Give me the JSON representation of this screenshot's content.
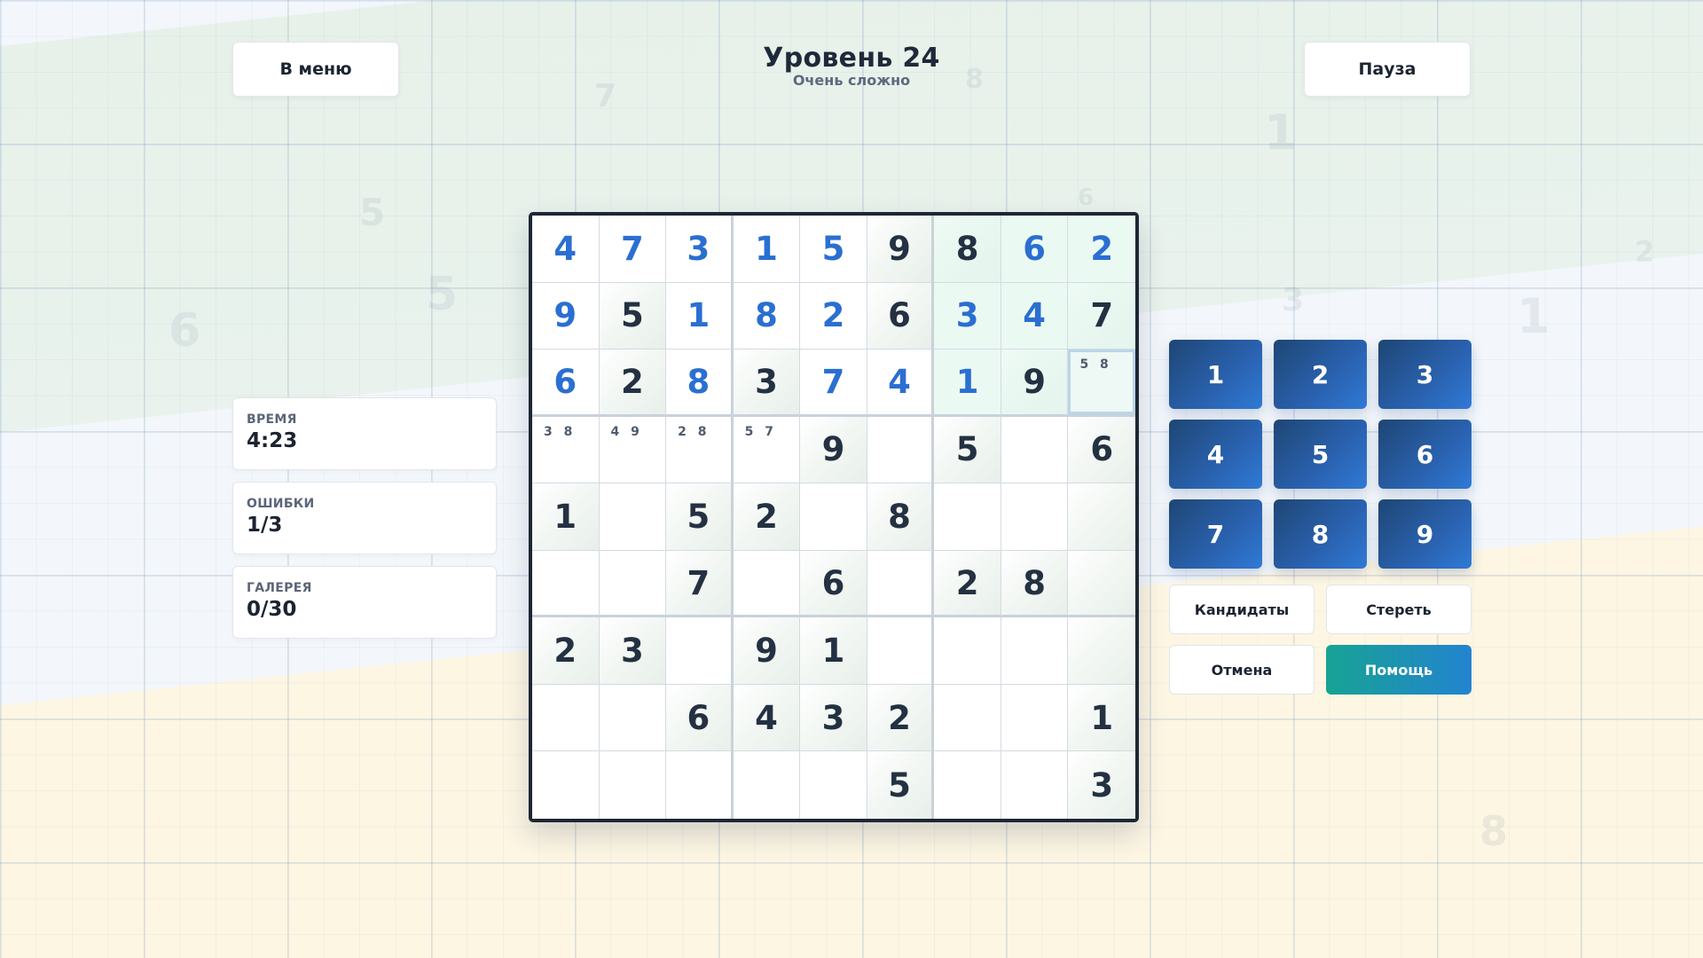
{
  "header": {
    "menu_label": "В меню",
    "title": "Уровень 24",
    "difficulty": "Очень сложно",
    "pause_label": "Пауза"
  },
  "stats": [
    {
      "label": "ВРЕМЯ",
      "value": "4:23"
    },
    {
      "label": "ОШИБКИ",
      "value": "1/3"
    },
    {
      "label": "ГАЛЕРЕЯ",
      "value": "0/30"
    }
  ],
  "board": {
    "rows": [
      [
        "4",
        "7",
        "3",
        "1",
        "5",
        "9",
        "8",
        "6",
        "2"
      ],
      [
        "9",
        "5",
        "1",
        "8",
        "2",
        "6",
        "3",
        "4",
        "7"
      ],
      [
        "6",
        "2",
        "8",
        "3",
        "7",
        "4",
        "1",
        "9",
        ""
      ],
      [
        "",
        "",
        "",
        "",
        "9",
        "",
        "5",
        "",
        "6"
      ],
      [
        "1",
        "",
        "5",
        "2",
        "",
        "8",
        "",
        "",
        ""
      ],
      [
        "",
        "",
        "7",
        "",
        "6",
        "",
        "2",
        "8",
        ""
      ],
      [
        "2",
        "3",
        "",
        "9",
        "1",
        "",
        "",
        "",
        ""
      ],
      [
        "",
        "",
        "6",
        "4",
        "3",
        "2",
        "",
        "",
        "1"
      ],
      [
        "",
        "",
        "",
        "",
        "",
        "5",
        "",
        "",
        "3"
      ]
    ],
    "user_entered": [
      [
        1,
        1,
        1,
        1,
        1,
        0,
        0,
        1,
        1
      ],
      [
        1,
        0,
        1,
        1,
        1,
        0,
        1,
        1,
        0
      ],
      [
        1,
        0,
        1,
        0,
        1,
        1,
        1,
        0,
        0
      ],
      [
        0,
        0,
        0,
        0,
        0,
        0,
        0,
        0,
        0
      ],
      [
        0,
        0,
        0,
        0,
        0,
        0,
        0,
        0,
        0
      ],
      [
        0,
        0,
        0,
        0,
        0,
        0,
        0,
        0,
        0
      ],
      [
        0,
        0,
        0,
        0,
        0,
        0,
        0,
        0,
        0
      ],
      [
        0,
        0,
        0,
        0,
        0,
        0,
        0,
        0,
        0
      ],
      [
        0,
        0,
        0,
        0,
        0,
        0,
        0,
        0,
        0
      ]
    ],
    "given": [
      [
        0,
        0,
        0,
        0,
        0,
        1,
        1,
        0,
        0
      ],
      [
        0,
        1,
        0,
        0,
        0,
        1,
        0,
        0,
        1
      ],
      [
        0,
        1,
        0,
        1,
        0,
        0,
        0,
        1,
        0
      ],
      [
        0,
        0,
        0,
        0,
        1,
        0,
        1,
        0,
        1
      ],
      [
        1,
        0,
        1,
        1,
        0,
        1,
        0,
        0,
        1
      ],
      [
        0,
        0,
        1,
        0,
        1,
        0,
        1,
        1,
        1
      ],
      [
        1,
        1,
        0,
        1,
        1,
        0,
        0,
        0,
        1
      ],
      [
        0,
        0,
        1,
        1,
        1,
        1,
        0,
        0,
        1
      ],
      [
        0,
        0,
        0,
        0,
        0,
        1,
        0,
        0,
        1
      ]
    ],
    "candidates": {
      "2-8": "5 8",
      "3-0": "3 8",
      "3-1": "4 9",
      "3-2": "2 8",
      "3-3": "5 7"
    },
    "selected": "2-8",
    "highlight_box": [
      0,
      6
    ]
  },
  "numpad": [
    "1",
    "2",
    "3",
    "4",
    "5",
    "6",
    "7",
    "8",
    "9"
  ],
  "actions": {
    "candidates_label": "Кандидаты",
    "erase_label": "Стереть",
    "undo_label": "Отмена",
    "help_label": "Помощь"
  },
  "background_digits": [
    "7",
    "8",
    "1",
    "5",
    "6",
    "5",
    "6",
    "3",
    "1",
    "2",
    "8"
  ],
  "colors": {
    "user_digit": "#2a6fd1",
    "given_digit": "#243142",
    "numpad_dark": "#1e4674",
    "numpad_light": "#2f7ad6",
    "help_start": "#17a394",
    "help_end": "#2383d0"
  }
}
